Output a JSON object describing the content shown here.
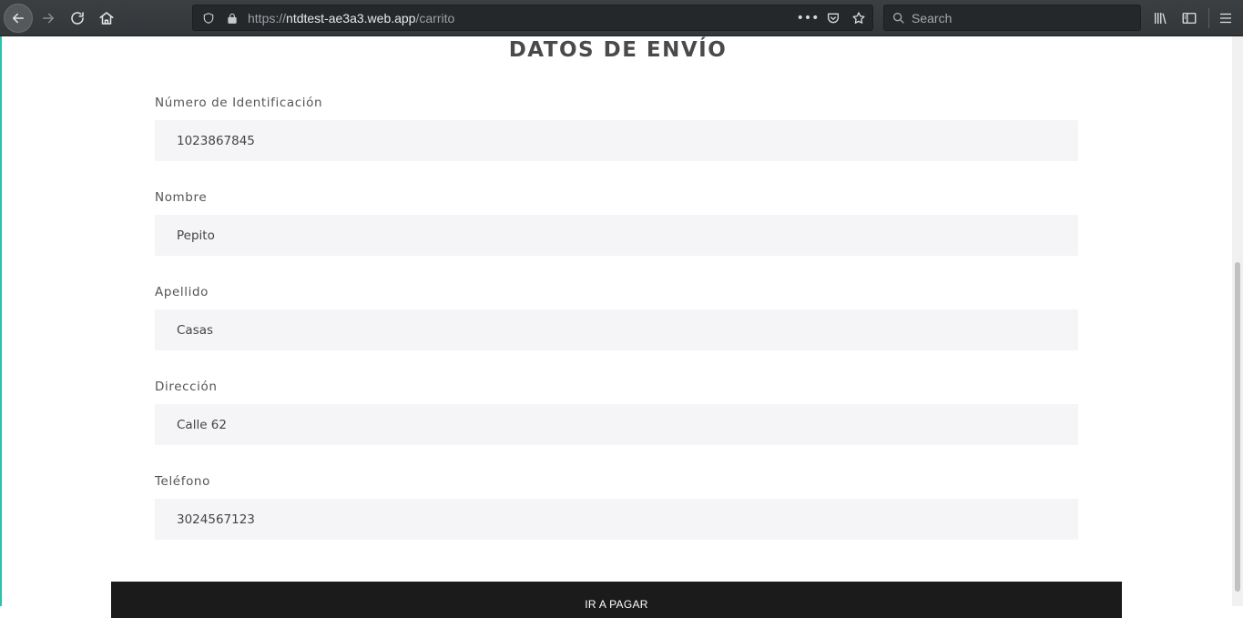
{
  "browser": {
    "url_scheme": "https://",
    "url_host": "ntdtest-ae3a3.web.app",
    "url_path": "/carrito",
    "search_placeholder": "Search",
    "overflow_label": "•••"
  },
  "page": {
    "title": "DATOS DE ENVÍO",
    "fields": [
      {
        "label": "Número de Identificación",
        "value": "1023867845"
      },
      {
        "label": "Nombre",
        "value": "Pepito"
      },
      {
        "label": "Apellido",
        "value": "Casas"
      },
      {
        "label": "Dirección",
        "value": "Calle 62"
      },
      {
        "label": "Teléfono",
        "value": "3024567123"
      }
    ],
    "pay_button_label": "IR A PAGAR"
  }
}
